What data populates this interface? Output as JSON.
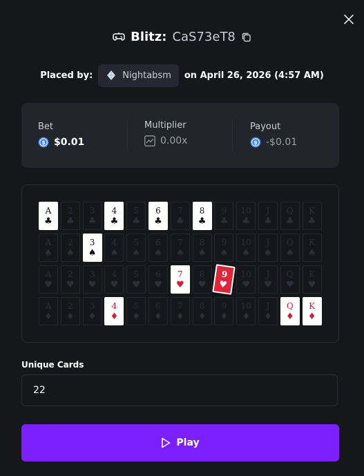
{
  "header": {
    "game_name": "Blitz:",
    "bet_id": "CaS73eT8"
  },
  "placed": {
    "prefix": "Placed by:",
    "user": "Nightabsm",
    "date": "on April 26, 2026 (4:57 AM)"
  },
  "stats": {
    "bet_label": "Bet",
    "bet_value": "$0.01",
    "multiplier_label": "Multiplier",
    "multiplier_value": "0.00x",
    "payout_label": "Payout",
    "payout_value": "-$0.01"
  },
  "board": {
    "ranks": [
      "A",
      "2",
      "3",
      "4",
      "5",
      "6",
      "7",
      "8",
      "9",
      "10",
      "J",
      "Q",
      "K"
    ],
    "suits": [
      {
        "name": "clubs",
        "symbol": "♣",
        "color": "black"
      },
      {
        "name": "spades",
        "symbol": "♠",
        "color": "black"
      },
      {
        "name": "hearts",
        "symbol": "♥",
        "color": "red"
      },
      {
        "name": "diamonds",
        "symbol": "♦",
        "color": "red"
      }
    ],
    "selected": {
      "clubs": [
        "A",
        "4",
        "6",
        "8"
      ],
      "spades": [
        "3"
      ],
      "hearts": [
        "7"
      ],
      "diamonds": [
        "4",
        "Q",
        "K"
      ]
    },
    "current_card": {
      "rank": "9",
      "suit": "hearts"
    }
  },
  "unique_cards": {
    "label": "Unique Cards",
    "value": "22"
  },
  "play_button": {
    "label": "Play"
  },
  "colors": {
    "background": "#16171b",
    "panel": "#22252c",
    "accent": "#7b1fff",
    "red_suit": "#d71935",
    "coin": "#3b82f6"
  }
}
